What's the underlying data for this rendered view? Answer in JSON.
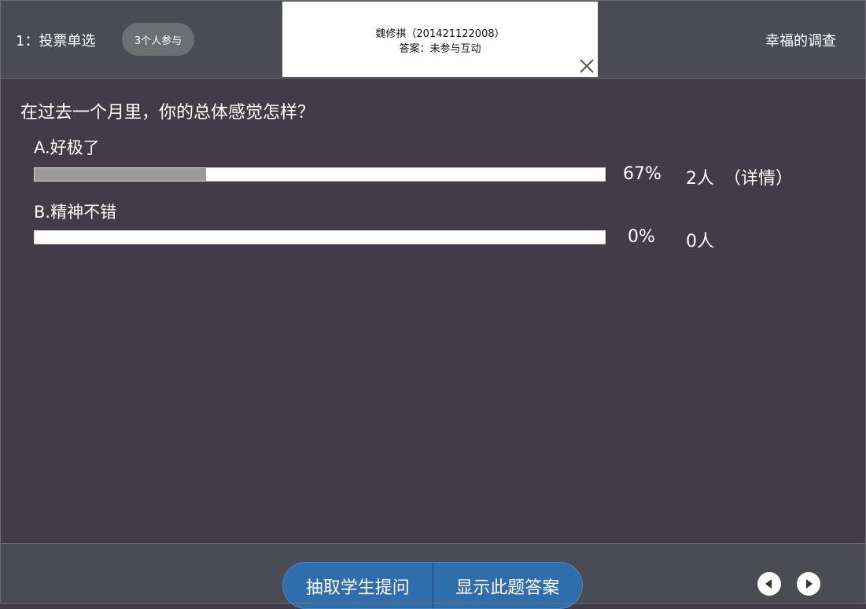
{
  "header": {
    "question_type": "1：投票单选",
    "participants_badge": "3个人参与",
    "survey_title": "幸福的调查"
  },
  "popup": {
    "student": "魏修祺（201421122008）",
    "answer": "答案：未参与互动"
  },
  "question": {
    "text": "在过去一个月里，你的总体感觉怎样？",
    "options": [
      {
        "label": "A.好极了",
        "percent_text": "67%",
        "count_text": "2人",
        "detail_text": "（详情）",
        "fill_fraction": 0.3
      },
      {
        "label": "B.精神不错",
        "percent_text": "0%",
        "count_text": "0人",
        "fill_fraction": 0
      }
    ]
  },
  "footer": {
    "pick_student_label": "抽取学生提问",
    "show_answer_label": "显示此题答案"
  },
  "colors": {
    "header_bg": "#4a4b53",
    "body_bg": "#423c4a",
    "bar_fill": "#9a9a9a",
    "button_blue": "#2f6dad"
  },
  "icons": {
    "close": "close-icon",
    "prev": "triangle-left-icon",
    "next": "triangle-right-icon"
  }
}
